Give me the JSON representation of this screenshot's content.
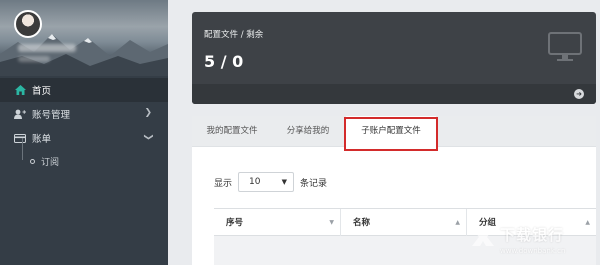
{
  "sidebar": {
    "items": [
      {
        "label": "首页",
        "icon": "home-icon"
      },
      {
        "label": "账号管理",
        "icon": "user-plus-icon"
      },
      {
        "label": "账单",
        "icon": "credit-card-icon"
      }
    ],
    "subitems": [
      {
        "label": "订阅"
      }
    ]
  },
  "stat": {
    "title": "配置文件 / 剩余",
    "value": "5 / 0"
  },
  "tabs": [
    {
      "label": "我的配置文件"
    },
    {
      "label": "分享给我的"
    },
    {
      "label": "子账户配置文件"
    }
  ],
  "length": {
    "prefix": "显示",
    "value": "10",
    "suffix": "条记录"
  },
  "table": {
    "headers": [
      "序号",
      "名称",
      "分组"
    ]
  },
  "watermark": {
    "text": "下载银行",
    "url": "www.downbank.cn"
  },
  "colors": {
    "sidebar_bg": "#343d46",
    "card_bg": "#3e4247",
    "highlight": "#d32b2b",
    "active_icon": "#2bb6a3"
  }
}
